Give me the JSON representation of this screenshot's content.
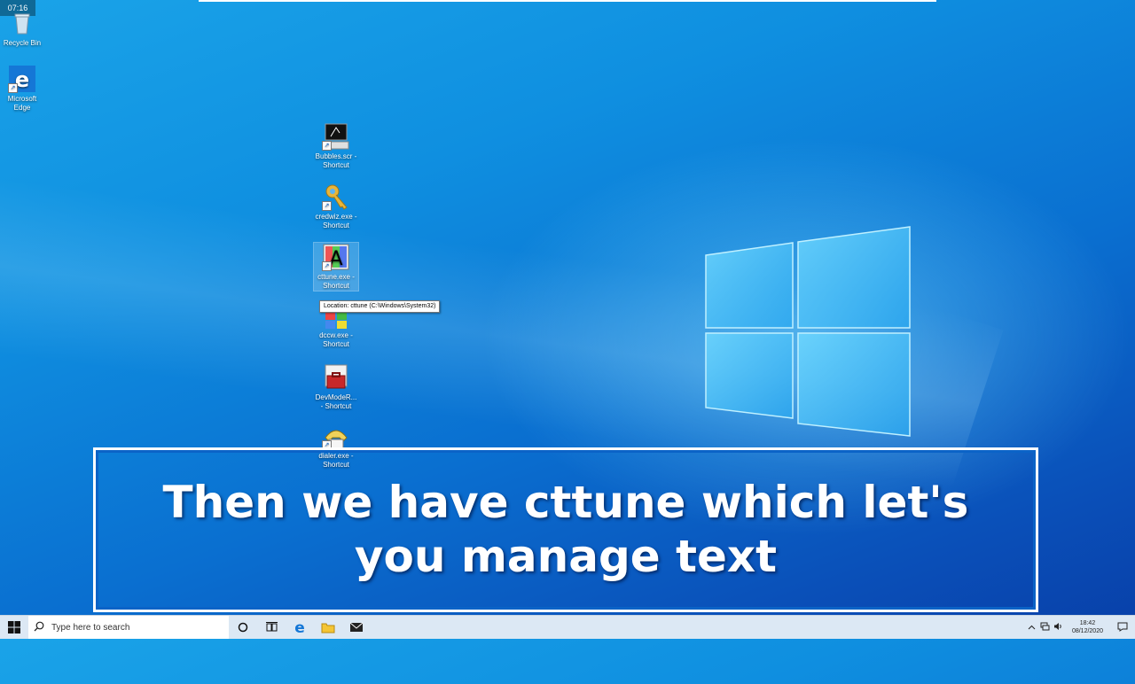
{
  "overlay": {
    "time_badge": "07:16",
    "caption": "Then we have cttune which let's you manage text"
  },
  "desktop": {
    "icons": [
      {
        "label": "Recycle Bin",
        "icon": "recycle-bin-icon"
      },
      {
        "label": "Microsoft Edge",
        "icon": "edge-icon"
      },
      {
        "label": "Bubbles.scr - Shortcut",
        "icon": "screensaver-icon"
      },
      {
        "label": "credwiz.exe - Shortcut",
        "icon": "key-icon"
      },
      {
        "label": "cttune.exe - Shortcut",
        "icon": "cleartype-icon"
      },
      {
        "label": "dccw.exe - Shortcut",
        "icon": "color-calibration-icon"
      },
      {
        "label": "DevModeR... - Shortcut",
        "icon": "toolbox-icon"
      },
      {
        "label": "dialer.exe - Shortcut",
        "icon": "phone-dialer-icon"
      }
    ],
    "tooltip": "Location: cttune (C:\\Windows\\System32)"
  },
  "taskbar": {
    "search_placeholder": "Type here to search",
    "time": "18:42",
    "date": "08/12/2020",
    "buttons": [
      "cortana-icon",
      "task-view-icon",
      "edge-icon",
      "file-explorer-icon",
      "mail-icon"
    ]
  },
  "colors": {
    "background_top": "#1aa3e8",
    "background_bottom": "#083fa8",
    "caption_border": "#ffffff",
    "taskbar": "#dce8f4"
  }
}
